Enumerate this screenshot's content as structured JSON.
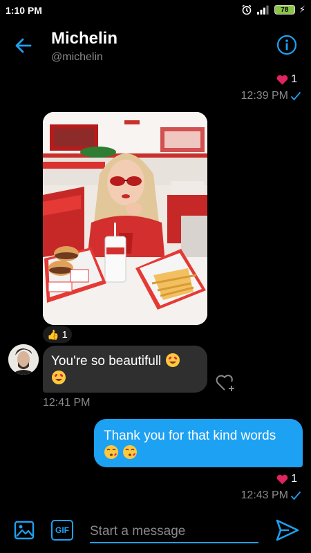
{
  "status_bar": {
    "time": "1:10 PM",
    "battery": "78"
  },
  "header": {
    "name": "Michelin",
    "handle": "@michelin"
  },
  "messages": {
    "first_reaction": {
      "count": "1"
    },
    "first_time": "12:39 PM",
    "image_like": {
      "count": "1"
    },
    "received": {
      "text": "You're so beautifull",
      "time": "12:41 PM"
    },
    "sent": {
      "text": "Thank you for that kind words",
      "time": "12:43 PM",
      "reaction_count": "1"
    }
  },
  "composer": {
    "placeholder": "Start a message",
    "gif_label": "GIF"
  },
  "colors": {
    "accent": "#1da1f2",
    "heart": "#e0245e",
    "bubble_in": "#2f2f2f",
    "muted": "#8a8a8a"
  }
}
